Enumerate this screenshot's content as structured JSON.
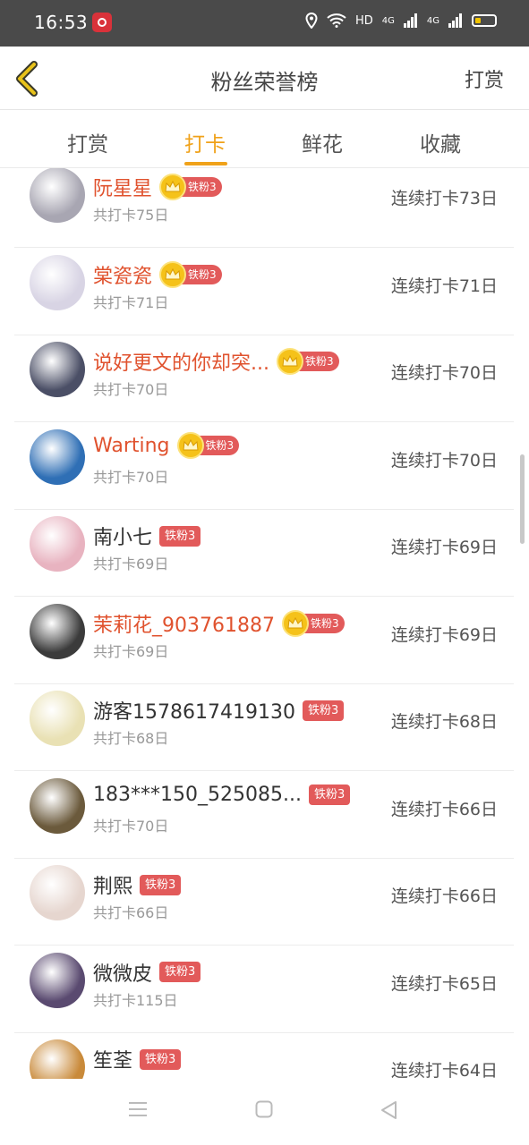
{
  "status_bar": {
    "time": "16:53",
    "network": "HD",
    "signal1": "4G",
    "signal2": "4G"
  },
  "header": {
    "title": "粉丝荣誉榜",
    "action": "打赏"
  },
  "tabs": [
    {
      "label": "打赏",
      "active": false
    },
    {
      "label": "打卡",
      "active": true
    },
    {
      "label": "鲜花",
      "active": false
    },
    {
      "label": "收藏",
      "active": false
    }
  ],
  "rows": [
    {
      "name": "阮星星",
      "badge": "铁粉3",
      "crown": true,
      "total": "共打卡75日",
      "streak": "连续打卡73日",
      "avatar_color": "#a8a6b2"
    },
    {
      "name": "棠瓷瓷",
      "badge": "铁粉3",
      "crown": true,
      "total": "共打卡71日",
      "streak": "连续打卡71日",
      "avatar_color": "#d8d4e4"
    },
    {
      "name": "说好更文的你却突...",
      "badge": "铁粉3",
      "crown": true,
      "total": "共打卡70日",
      "streak": "连续打卡70日",
      "avatar_color": "#4b4f66"
    },
    {
      "name": "Warting",
      "badge": "铁粉3",
      "crown": true,
      "total": "共打卡70日",
      "streak": "连续打卡70日",
      "avatar_color": "#2f6fb5"
    },
    {
      "name": "南小七",
      "badge": "铁粉3",
      "crown": false,
      "total": "共打卡69日",
      "streak": "连续打卡69日",
      "avatar_color": "#e8b3c0"
    },
    {
      "name": "茉莉花_903761887",
      "badge": "铁粉3",
      "crown": true,
      "total": "共打卡69日",
      "streak": "连续打卡69日",
      "avatar_color": "#3b3b3b"
    },
    {
      "name": "游客1578617419130",
      "badge": "铁粉3",
      "crown": false,
      "total": "共打卡68日",
      "streak": "连续打卡68日",
      "avatar_color": "#e9e1b4"
    },
    {
      "name": "183***150_525085...",
      "badge": "铁粉3",
      "crown": false,
      "total": "共打卡70日",
      "streak": "连续打卡66日",
      "avatar_color": "#6b5a3c"
    },
    {
      "name": "荆熙",
      "badge": "铁粉3",
      "crown": false,
      "total": "共打卡66日",
      "streak": "连续打卡66日",
      "avatar_color": "#e6d6cf"
    },
    {
      "name": "微微皮",
      "badge": "铁粉3",
      "crown": false,
      "total": "共打卡115日",
      "streak": "连续打卡65日",
      "avatar_color": "#5a4a70"
    },
    {
      "name": "笙荃",
      "badge": "铁粉3",
      "crown": false,
      "total": "",
      "streak": "连续打卡64日",
      "avatar_color": "#c98a3a"
    }
  ],
  "colors": {
    "accent": "#f0a21a",
    "vip_name": "#e0522e",
    "badge": "#e25a5a"
  },
  "icons": {
    "back": "chevron-left-icon",
    "menu": "menu-icon",
    "home": "home-icon",
    "back_nav": "triangle-back-icon"
  }
}
